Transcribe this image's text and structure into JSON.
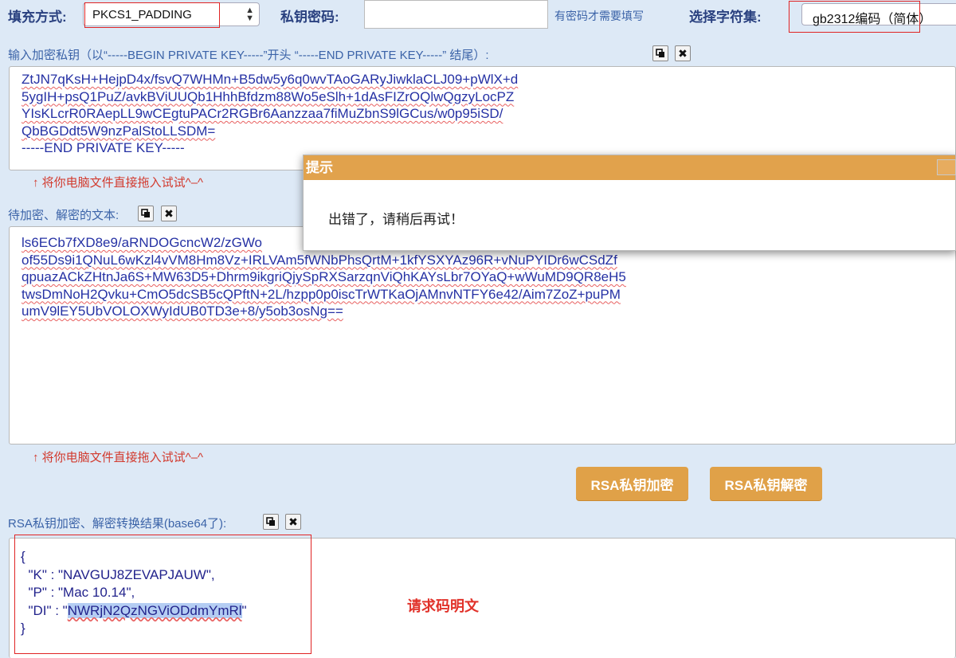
{
  "topbar": {
    "padding_label": "填充方式:",
    "padding_value": "PKCS1_PADDING",
    "password_label": "私钥密码:",
    "password_value": "",
    "password_hint": "有密码才需要填写",
    "charset_label": "选择字符集:",
    "charset_value": "gb2312编码（简体）"
  },
  "private_key": {
    "label": "输入加密私钥（以“-----BEGIN PRIVATE KEY-----”开头 “-----END PRIVATE KEY-----” 结尾）:",
    "lines": [
      "ZtJN7qKsH+HejpD4x/fsvQ7WHMn+B5dw5y6q0wvTAoGARyJiwklaCLJ09+pWlX+d",
      "5ygIH+psQ1PuZ/avkBViUUQb1HhhBfdzm88Wo5eSlh+1dAsFIZrOQlwQgzyLocPZ",
      "YIsKLcrR0RAepLL9wCEgtuPACr2RGBr6Aanzzaa7fiMuZbnS9lGCus/w0p95iSD/",
      "QbBGDdt5W9nzPalStoLLSDM=",
      "-----END PRIVATE KEY-----"
    ],
    "drag_hint": "↑ 将你电脑文件直接拖入试试^–^"
  },
  "text_input": {
    "label": "待加密、解密的文本:",
    "lines": [
      "ls6ECb7fXD8e9/aRNDOGcncW2/zGWo",
      "of55Ds9i1QNuL6wKzl4vVM8Hm8Vz+IRLVAm5fWNbPhsQrtM+1kfYSXYAz96R+vNuPYIDr6wCSdZf",
      "qpuazACkZHtnJa6S+MW63D5+Dhrm9ikgriQjySpRXSarzqnViQhKAYsLbr7OYaQ+wWuMD9QR8eH5",
      "twsDmNoH2Qvku+CmO5dcSB5cQPftN+2L/hzpp0p0iscTrWTKaOjAMnvNTFY6e42/Aim7ZoZ+puPM",
      "umV9lEY5UbVOLOXWyIdUB0TD3e+8/y5ob3osNg=="
    ],
    "drag_hint": "↑ 将你电脑文件直接拖入试试^–^"
  },
  "actions": {
    "encrypt_label": "RSA私钥加密",
    "decrypt_label": "RSA私钥解密"
  },
  "result": {
    "label": "RSA私钥加密、解密转换结果(base64了):",
    "open_brace": "{",
    "k_line": "  \"K\" : \"NAVGUJ8ZEVAPJAUW\",",
    "p_line": "  \"P\" : \"Mac 10.14\",",
    "di_prefix": "  \"DI\" : \"",
    "di_value": "NWRjN2QzNGViODdmYmRl",
    "di_suffix": "\"",
    "close_brace": "}",
    "annotation": "请求码明文"
  },
  "dialog": {
    "title": "提示",
    "message": "出错了，请稍后再试！"
  },
  "colors": {
    "page_bg": "#dde9f6",
    "accent_orange": "#e0a148",
    "annotation_red": "#e1322a"
  }
}
